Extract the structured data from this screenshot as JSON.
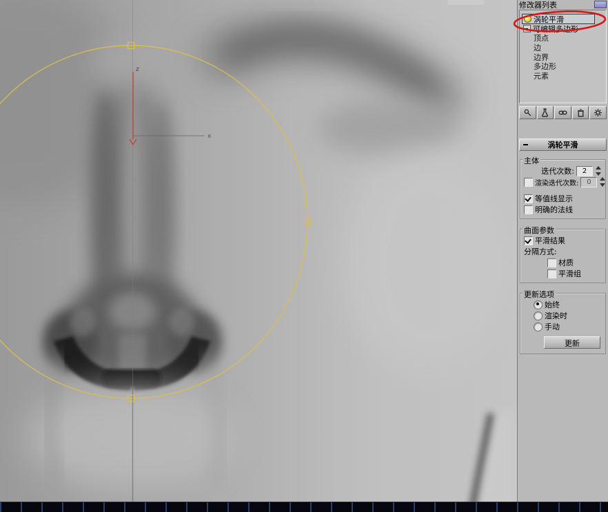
{
  "colors": {
    "selection_circle_yellow": "#D8BD52",
    "annotation_red": "#D21818",
    "axis_z_red": "#C43B3B",
    "panel_gray": "#B9B9B9",
    "viewport_gray": "#A8A8A8",
    "bottom_bar": "#06060F"
  },
  "viewport": {
    "axis_z_label": "z",
    "axis_x_label": "x"
  },
  "panel": {
    "modifier_list_label": "修改器列表",
    "stack_items": [
      {
        "label": "涡轮平滑"
      },
      {
        "label": "可编辑多边形"
      },
      {
        "label": "顶点"
      },
      {
        "label": "边"
      },
      {
        "label": "边界"
      },
      {
        "label": "多边形"
      },
      {
        "label": "元素"
      }
    ],
    "stack_toolbar_icons": [
      "pin-stack-icon",
      "show-end-result-icon",
      "make-unique-icon",
      "remove-modifier-icon",
      "configure-modifier-sets-icon"
    ],
    "rollout_title": "涡轮平滑",
    "main_group": {
      "title": "主体",
      "iterations_label": "迭代次数:",
      "iterations_value": "2",
      "render_iterations_label": "渲染迭代次数:",
      "render_iterations_value": "0",
      "isoline_display_label": "等值线显示",
      "explicit_normals_label": "明确的法线"
    },
    "surface_group": {
      "title": "曲面参数",
      "smooth_result_label": "平滑结果",
      "separate_by_label": "分隔方式:",
      "materials_label": "材质",
      "smoothing_groups_label": "平滑组"
    },
    "update_group": {
      "title": "更新选项",
      "always_label": "始终",
      "when_rendering_label": "渲染时",
      "manually_label": "手动",
      "update_button_label": "更新"
    }
  }
}
